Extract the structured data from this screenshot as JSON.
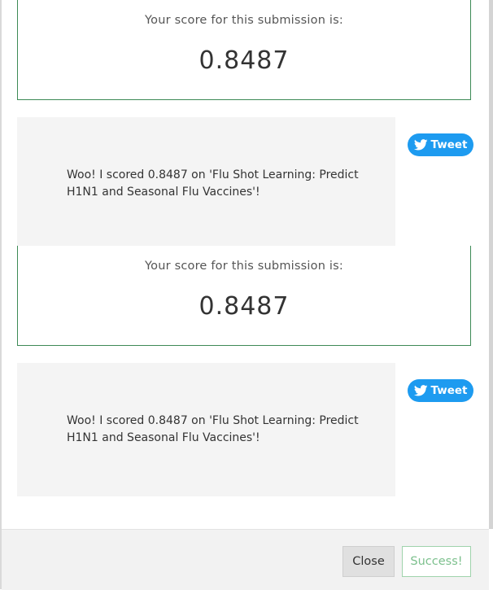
{
  "submissions": [
    {
      "score_label": "Your score for this submission is:",
      "score_value": "0.8487",
      "share_message": "Woo! I scored 0.8487 on 'Flu Shot Learning: Predict H1N1 and Seasonal Flu Vaccines'!",
      "tweet_label": "Tweet"
    },
    {
      "score_label": "Your score for this submission is:",
      "score_value": "0.8487",
      "share_message": "Woo! I scored 0.8487 on 'Flu Shot Learning: Predict H1N1 and Seasonal Flu Vaccines'!",
      "tweet_label": "Tweet"
    }
  ],
  "footer": {
    "close_label": "Close",
    "success_label": "Success!"
  },
  "colors": {
    "tweet_blue": "#1d9bf0",
    "score_border": "#3d8a56",
    "success_text": "#7cc08d"
  },
  "icons": {
    "tweet": "twitter-bird-icon"
  }
}
